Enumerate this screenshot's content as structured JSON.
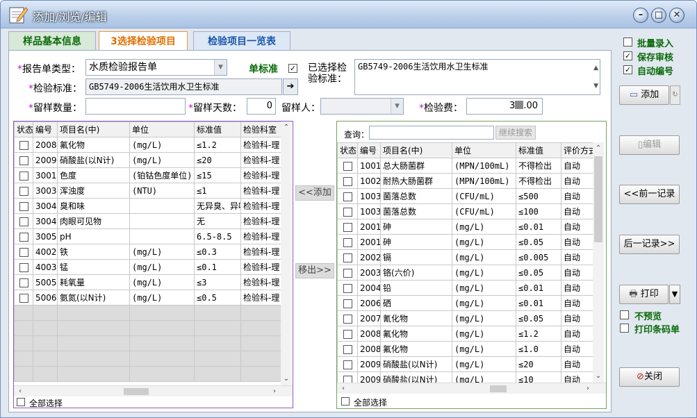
{
  "window": {
    "title": "添加/浏览/编辑"
  },
  "tabs": [
    {
      "label": "样品基本信息"
    },
    {
      "label": "3选择检验项目"
    },
    {
      "label": "检验项目一览表"
    }
  ],
  "form": {
    "report_type_label": "报告单类型：",
    "report_type_value": "水质检验报告单",
    "single_standard_label": "单标准",
    "single_standard_checked": "✓",
    "selected_standard_label1": "已选择检",
    "selected_standard_label2": "验标准：",
    "selected_standard_value": "GB5749-2006生活饮用水卫生标准",
    "standard_label": "检验标准：",
    "standard_value": "GB5749-2006生活饮用水卫生标准",
    "sample_qty_label": "留样数量：",
    "sample_qty_value": "",
    "sample_days_label": "留样天数：",
    "sample_days_value": "0",
    "sample_person_label": "留样人：",
    "sample_person_value": "",
    "fee_label": "检验费：",
    "fee_value_a": "3",
    "fee_value_b": ".00"
  },
  "left_table": {
    "headers": [
      "状态",
      "编号",
      "项目名(中)",
      "单位",
      "标准值",
      "检验科室"
    ],
    "rows": [
      [
        "2008",
        "氟化物",
        "(mg/L)",
        "≤1.2",
        "检验科-理"
      ],
      [
        "2009",
        "硝酸盐(以N计)",
        "(mg/L)",
        "≤20",
        "检验科-理"
      ],
      [
        "3001",
        "色度",
        "(铂钴色度单位)",
        "≤15",
        "检验科-理"
      ],
      [
        "3003",
        "浑浊度",
        "(NTU)",
        "≤1",
        "检验科-理"
      ],
      [
        "3004",
        "臭和味",
        "",
        "无异臭、异味",
        "检验科-理"
      ],
      [
        "3004",
        "肉眼可见物",
        "",
        "无",
        "检验科-理"
      ],
      [
        "3005",
        "pH",
        "",
        "6.5-8.5",
        "检验科-理"
      ],
      [
        "4002",
        "铁",
        "(mg/L)",
        "≤0.3",
        "检验科-理"
      ],
      [
        "4003",
        "锰",
        "(mg/L)",
        "≤0.1",
        "检验科-理"
      ],
      [
        "5005",
        "耗氧量",
        "(mg/L)",
        "≤3",
        "检验科-理"
      ],
      [
        "5006",
        "氨氮(以N计)",
        "(mg/L)",
        "≤0.5",
        "检验科-理"
      ]
    ],
    "select_all": "全部选择"
  },
  "middle": {
    "add_label": "<<添加",
    "remove_label": "移出>>"
  },
  "right_table": {
    "query_label": "查询：",
    "query_value": "",
    "continue_search": "继续搜索",
    "headers": [
      "状态",
      "编号",
      "项目名(中)",
      "单位",
      "标准值",
      "评价方式"
    ],
    "rows": [
      [
        "1001",
        "总大肠菌群",
        "(MPN/100mL)",
        "不得检出",
        "自动"
      ],
      [
        "1002",
        "耐热大肠菌群",
        "(MPN/100mL)",
        "不得检出",
        "自动"
      ],
      [
        "1003",
        "菌落总数",
        "(CFU/mL)",
        "≤500",
        "自动"
      ],
      [
        "1003",
        "菌落总数",
        "(CFU/mL)",
        "≤100",
        "自动"
      ],
      [
        "2001",
        "砷",
        "(mg/L)",
        "≤0.01",
        "自动"
      ],
      [
        "2001",
        "砷",
        "(mg/L)",
        "≤0.05",
        "自动"
      ],
      [
        "2002",
        "镉",
        "(mg/L)",
        "≤0.005",
        "自动"
      ],
      [
        "2003",
        "铬(六价)",
        "(mg/L)",
        "≤0.05",
        "自动"
      ],
      [
        "2004",
        "铅",
        "(mg/L)",
        "≤0.01",
        "自动"
      ],
      [
        "2006",
        "硒",
        "(mg/L)",
        "≤0.01",
        "自动"
      ],
      [
        "2007",
        "氰化物",
        "(mg/L)",
        "≤0.05",
        "自动"
      ],
      [
        "2008",
        "氟化物",
        "(mg/L)",
        "≤1.2",
        "自动"
      ],
      [
        "2008",
        "氟化物",
        "(mg/L)",
        "≤1.0",
        "自动"
      ],
      [
        "2009",
        "硝酸盐(以N计)",
        "(mg/L)",
        "≤20",
        "自动"
      ],
      [
        "2009",
        "硝酸盐(以N计)",
        "(mg/L)",
        "≤10",
        "自动"
      ]
    ],
    "select_all": "全部选择"
  },
  "side": {
    "batch_entry": "批量录入",
    "batch_entry_checked": "",
    "save_review": "保存审核",
    "save_review_checked": "✓",
    "auto_number": "自动编号",
    "auto_number_checked": "✓",
    "add": "添加",
    "edit": "编辑",
    "prev": "<<前一记录",
    "next": "后一记录>>",
    "print": "打印",
    "no_preview": "不预览",
    "print_barcode": "打印条码单",
    "close": "关闭"
  }
}
